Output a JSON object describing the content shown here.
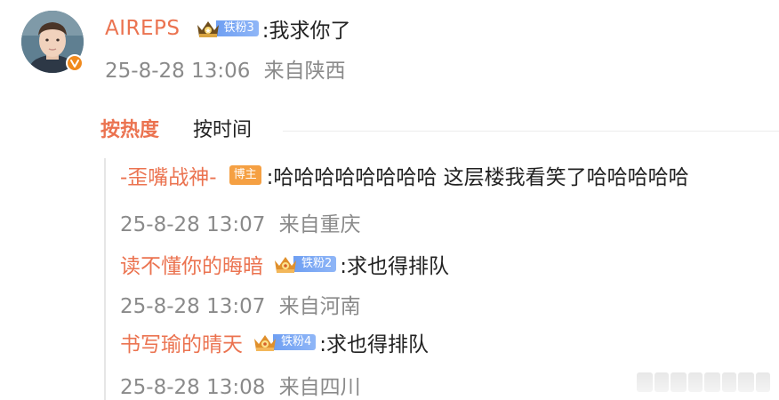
{
  "main_comment": {
    "username": "AIREPS",
    "fan_badge": {
      "icon": "crown-icon",
      "label": "铁粉3"
    },
    "text": ":我求你了",
    "date": "25-8-28 13:06",
    "location": "来自陕西",
    "verified": true
  },
  "sort_tabs": [
    {
      "label": "按热度",
      "active": true
    },
    {
      "label": "按时间",
      "active": false
    }
  ],
  "replies": [
    {
      "username": "-歪嘴战神-",
      "badge_type": "author",
      "badge_label": "博主",
      "text": ":哈哈哈哈哈哈哈哈 这层楼我看笑了哈哈哈哈哈",
      "date": "25-8-28 13:07",
      "location": "来自重庆"
    },
    {
      "username": "读不懂你的晦暗",
      "badge_type": "fan",
      "badge_label": "铁粉2",
      "text": ":求也得排队",
      "date": "25-8-28 13:07",
      "location": "来自河南"
    },
    {
      "username": "书写瑜的晴天",
      "badge_type": "fan",
      "badge_label": "铁粉4",
      "text": ":求也得排队",
      "date": "25-8-28 13:08",
      "location": "来自四川"
    }
  ],
  "colors": {
    "username": "#eb7350",
    "meta": "#8a8a8a",
    "fan_badge": "#7aa7f4",
    "author_badge": "#f5a043",
    "verify_badge": "#f08a1e"
  }
}
